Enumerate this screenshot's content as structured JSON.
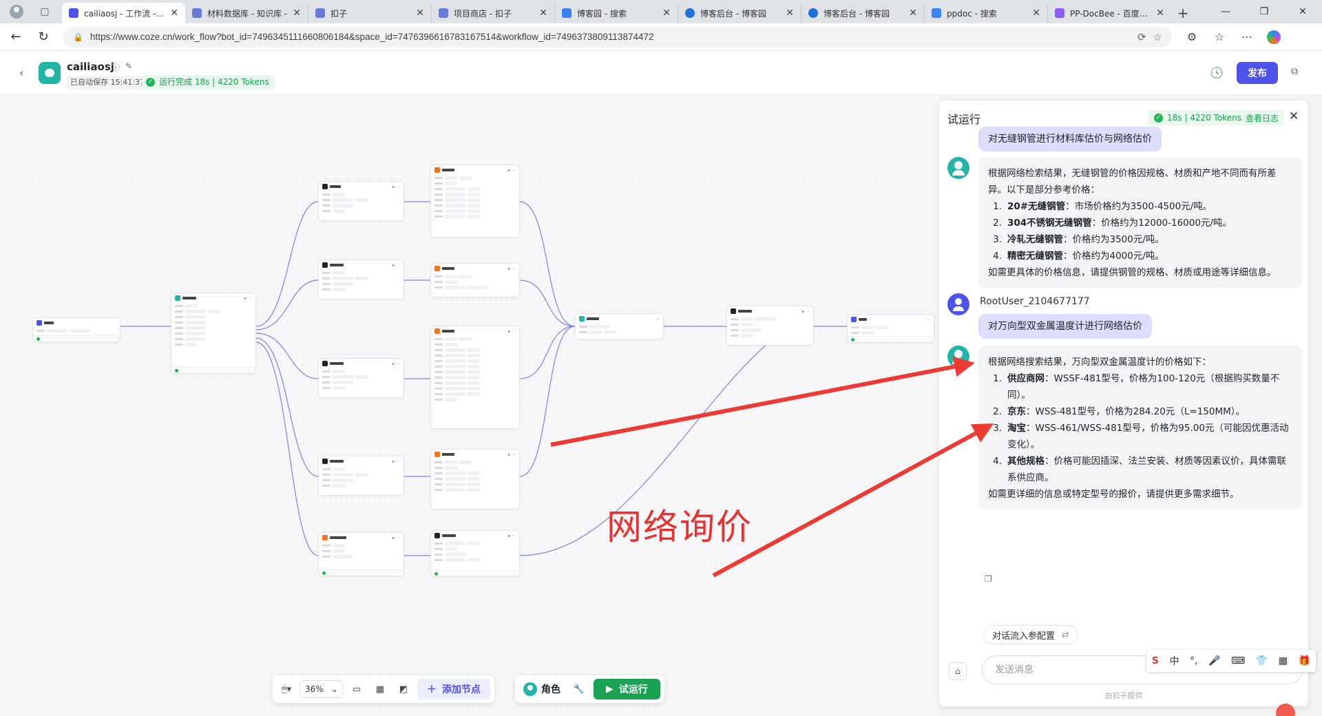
{
  "browser": {
    "tabs": [
      {
        "label": "cailiaosj - 工作流 -智能",
        "color": "#4d53e8",
        "active": true
      },
      {
        "label": "材料数据库 - 知识库 -",
        "color": "#6b7bd8"
      },
      {
        "label": "扣子",
        "color": "#6b7bd8"
      },
      {
        "label": "项目商店 - 扣子",
        "color": "#6b7bd8"
      },
      {
        "label": "博客园 - 搜索",
        "color": "#3b82f6"
      },
      {
        "label": "博客后台 - 博客园",
        "color": "#1e6fd9"
      },
      {
        "label": "博客后台 - 博客园",
        "color": "#1e6fd9"
      },
      {
        "label": "ppdoc - 搜索",
        "color": "#3b82f6"
      },
      {
        "label": "PP-DocBee - 百度飞桨",
        "color": "#8b5cf6"
      }
    ],
    "url": "https://www.coze.cn/work_flow?bot_id=7496345111660806184&space_id=7476396616783167514&workflow_id=7496373809113874472"
  },
  "header": {
    "app_name": "cailiaosj",
    "autosave": "已自动保存 15:41:37",
    "run_status": "运行完成 18s | 4220 Tokens",
    "publish_label": "发布"
  },
  "canvas": {
    "annotation": "网络询价",
    "zoom": "36%",
    "add_node_label": "添加节点",
    "role_label": "角色",
    "trial_run_label": "试运行"
  },
  "panel": {
    "title": "试运行",
    "badge_stats": "18s | 4220 Tokens",
    "badge_link": "查看日志",
    "messages": {
      "user_query_1": "对无缝钢管进行材料库估价与网络估价",
      "bot_reply_1": {
        "intro": "根据网络检索结果，无缝钢管的价格因规格、材质和产地不同而有所差异。以下是部分参考价格：",
        "items": [
          {
            "n": "1.",
            "bold": "20#无缝钢管",
            "text": "：市场价格约为3500-4500元/吨。"
          },
          {
            "n": "2.",
            "bold": "304不锈钢无缝钢管",
            "text": "：价格约为12000-16000元/吨。"
          },
          {
            "n": "3.",
            "bold": "冷轧无缝钢管",
            "text": "：价格约为3500元/吨。"
          },
          {
            "n": "4.",
            "bold": "精密无缝钢管",
            "text": "：价格约为4000元/吨。"
          }
        ],
        "outro": "如需更具体的价格信息，请提供钢管的规格、材质或用途等详细信息。"
      },
      "user_name": "RootUser_2104677177",
      "user_query_2": "对万向型双金属温度计进行网络估价",
      "bot_reply_2": {
        "intro": "根据网络搜索结果，万向型双金属温度计的价格如下：",
        "items": [
          {
            "n": "1.",
            "bold": "供应商网",
            "text": "：WSSF-481型号，价格为100-120元（根据购买数量不同）。"
          },
          {
            "n": "2.",
            "bold": "京东",
            "text": "：WSS-481型号，价格为284.20元（L=150MM）。"
          },
          {
            "n": "3.",
            "bold": "淘宝",
            "text": "：WSS-461/WSS-481型号，价格为95.00元（可能因优惠活动变化）。"
          },
          {
            "n": "4.",
            "bold": "其他规格",
            "text": "：价格可能因插深、法兰安装、材质等因素议价，具体需联系供应商。"
          }
        ],
        "outro": "如需更详细的信息或特定型号的报价，请提供更多需求细节。"
      }
    },
    "suggestion": "对话流入参配置",
    "input_placeholder": "发送消息",
    "footnote": "由扣子提供"
  },
  "ime": {
    "items": [
      "S",
      "中",
      "°,",
      "🎤",
      "⌨",
      "👕",
      "▦",
      "🎁"
    ]
  }
}
